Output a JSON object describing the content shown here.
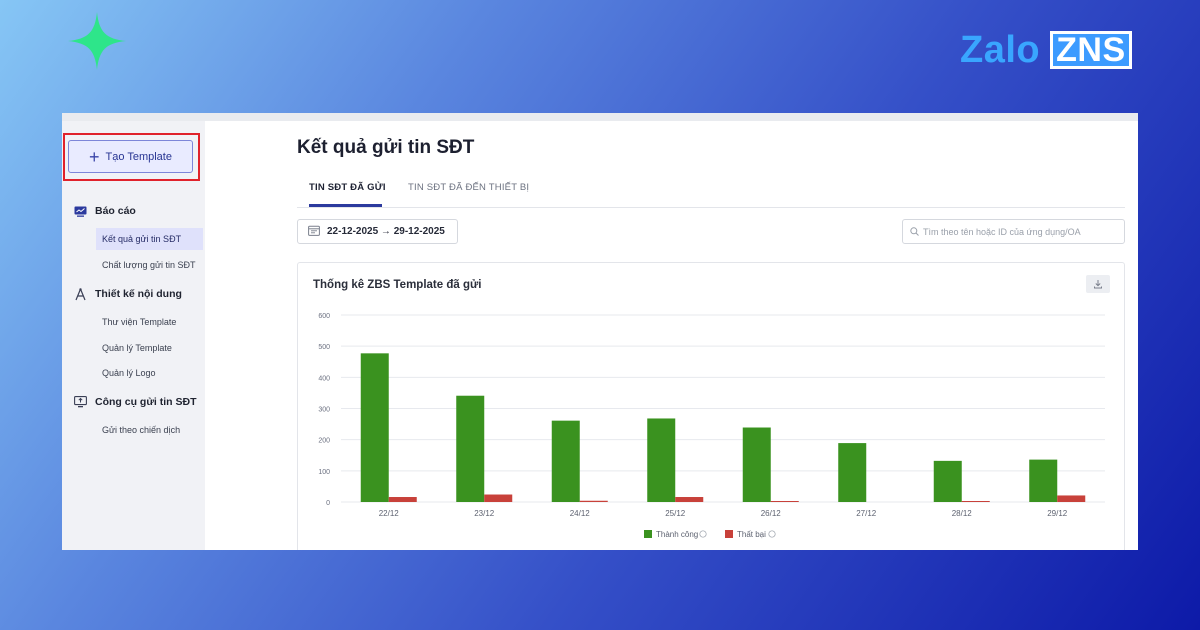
{
  "brand": {
    "zalo": "Zalo",
    "zns": "ZNS"
  },
  "sidebar": {
    "create_button": "Tạo Template",
    "groups": [
      {
        "label": "Báo cáo",
        "icon": "monitor-chart-icon",
        "items": [
          {
            "label": "Kết quả gửi tin SĐT",
            "active": true
          },
          {
            "label": "Chất lượng gửi tin SĐT",
            "active": false
          }
        ]
      },
      {
        "label": "Thiết kế nội dung",
        "icon": "design-compass-icon",
        "items": [
          {
            "label": "Thư viện Template"
          },
          {
            "label": "Quản lý Template"
          },
          {
            "label": "Quản lý Logo"
          }
        ]
      },
      {
        "label": "Công cụ gửi tin SĐT",
        "icon": "send-screen-icon",
        "items": [
          {
            "label": "Gửi theo chiến dịch"
          }
        ]
      }
    ]
  },
  "main": {
    "title": "Kết quả gửi tin SĐT",
    "tabs": [
      {
        "label": "TIN SĐT ĐÃ GỬI",
        "active": true
      },
      {
        "label": "TIN SĐT ĐÃ ĐẾN THIẾT BỊ",
        "active": false
      }
    ],
    "date_range": "22-12-2025 → 29-12-2025",
    "search_placeholder": "Tìm theo tên hoặc ID của ứng dụng/OA"
  },
  "colors": {
    "success": "#3a921f",
    "failure": "#c8413a",
    "accent": "#2c3a9e",
    "highlight": "#e0222b"
  },
  "chart_data": {
    "type": "bar",
    "title": "Thống kê ZBS Template đã gửi",
    "categories": [
      "22/12",
      "23/12",
      "24/12",
      "25/12",
      "26/12",
      "27/12",
      "28/12",
      "29/12"
    ],
    "series": [
      {
        "name": "Thành công",
        "values": [
          477,
          341,
          261,
          268,
          239,
          189,
          132,
          136
        ]
      },
      {
        "name": "Thất bại",
        "values": [
          16,
          24,
          4,
          16,
          2,
          0,
          3,
          21
        ]
      }
    ],
    "yticks": [
      0,
      100,
      200,
      300,
      400,
      500,
      600
    ],
    "ylim": [
      0,
      600
    ],
    "grid": true,
    "legend": "bottom-center"
  }
}
